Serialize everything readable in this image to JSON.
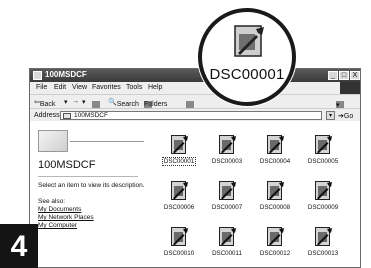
{
  "window": {
    "title": "100MSDCF",
    "controls": {
      "minimize": "_",
      "maximize": "□",
      "close": "X"
    }
  },
  "menubar": {
    "items": [
      "File",
      "Edit",
      "View",
      "Favorites",
      "Tools",
      "Help"
    ]
  },
  "toolbar": {
    "back": "Back",
    "forward_arrow": "→",
    "dropdown_arrow": "▾",
    "search": "Search",
    "folders": "Folders"
  },
  "address": {
    "label": "Address",
    "value": "100MSDCF",
    "dropdown": "▾",
    "go": "Go"
  },
  "leftpane": {
    "folder_name": "100MSDCF",
    "hint": "Select an item to view its description.",
    "see_also": "See also:",
    "links": [
      "My Documents",
      "My Network Places",
      "My Computer"
    ]
  },
  "files": [
    {
      "name": "DSC00001",
      "selected": true
    },
    {
      "name": "DSC00003",
      "selected": false
    },
    {
      "name": "DSC00004",
      "selected": false
    },
    {
      "name": "DSC00005",
      "selected": false
    },
    {
      "name": "DSC00006",
      "selected": false
    },
    {
      "name": "DSC00007",
      "selected": false
    },
    {
      "name": "DSC00008",
      "selected": false
    },
    {
      "name": "DSC00009",
      "selected": false
    },
    {
      "name": "DSC00010",
      "selected": false
    },
    {
      "name": "DSC00011",
      "selected": false
    },
    {
      "name": "DSC00012",
      "selected": false
    },
    {
      "name": "DSC00013",
      "selected": false
    }
  ],
  "callout": {
    "label": "DSC00001"
  },
  "step": {
    "number": "4"
  }
}
